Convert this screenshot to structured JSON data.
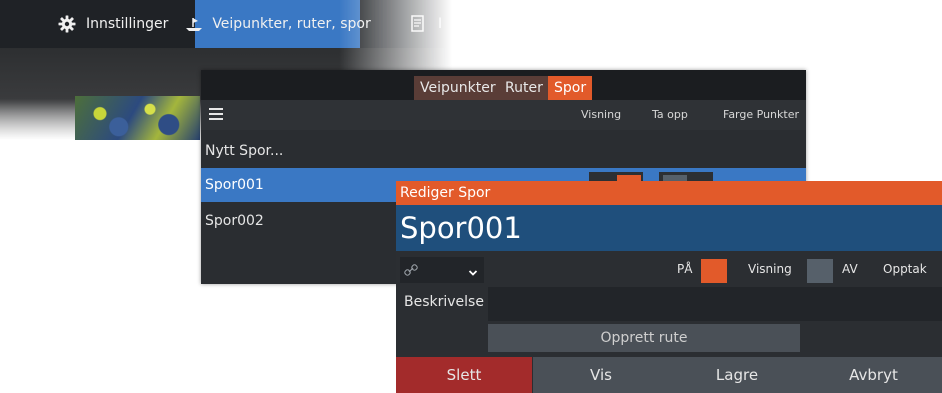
{
  "topbar": {
    "tabs": [
      {
        "label": "Innstillinger",
        "icon": "gear-icon"
      },
      {
        "label": "Veipunkter, ruter, spor",
        "icon": "waypoint-icon"
      },
      {
        "label": "I",
        "icon": "document-icon"
      }
    ]
  },
  "panel": {
    "tabs": [
      "Veipunkter",
      "Ruter",
      "Spor"
    ],
    "active_tab": "Spor",
    "headers": {
      "view": "Visning",
      "record": "Ta opp",
      "color": "Farge",
      "points": "Punkter"
    },
    "rows": [
      {
        "label": "Nytt Spor..."
      },
      {
        "label": "Spor001",
        "selected": true
      },
      {
        "label": "Spor002"
      }
    ]
  },
  "dialog": {
    "title": "Rediger Spor",
    "name": "Spor001",
    "color_select_icon": "link-icon",
    "on_label": "PÅ",
    "display_label": "Visning",
    "off_label": "AV",
    "record_label": "Opptak",
    "description_label": "Beskrivelse",
    "description_value": "",
    "create_route_label": "Opprett rute",
    "buttons": {
      "delete": "Slett",
      "show": "Vis",
      "save": "Lagre",
      "cancel": "Avbryt"
    }
  },
  "colors": {
    "accent_orange": "#e25a2a",
    "selection_blue": "#3a78c4",
    "title_blue": "#1f4f7c",
    "delete_red": "#a32b2b"
  }
}
